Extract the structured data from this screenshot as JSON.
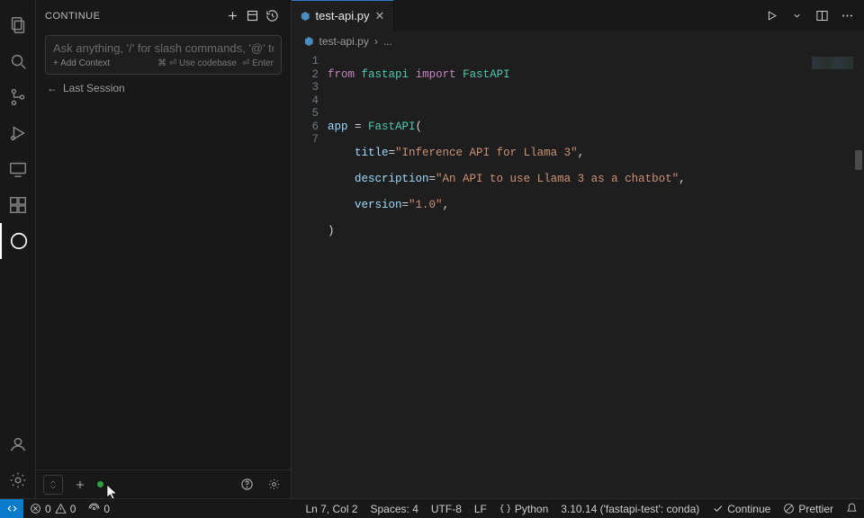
{
  "sidebar": {
    "title": "CONTINUE",
    "input_placeholder": "Ask anything, '/' for slash commands, '@' to add",
    "add_context": "+ Add Context",
    "hint_codebase": "⌘ ⏎ Use codebase",
    "hint_enter": "⏎ Enter",
    "last_session_arrow": "←",
    "last_session": "Last Session"
  },
  "tab": {
    "filename": "test-api.py",
    "file_icon": "⬢"
  },
  "breadcrumb": {
    "file_icon": "⬢",
    "file": "test-api.py",
    "sep": "›",
    "more": "..."
  },
  "code": {
    "lines": [
      "1",
      "2",
      "3",
      "4",
      "5",
      "6",
      "7"
    ],
    "l1_from": "from",
    "l1_mod": "fastapi",
    "l1_import": "import",
    "l1_cls": "FastAPI",
    "l3_app": "app",
    "l3_eq": " = ",
    "l3_cls": "FastAPI",
    "l3_open": "(",
    "l4_kw": "title",
    "l4_eq": "=",
    "l4_str": "\"Inference API for Llama 3\"",
    "l4_comma": ",",
    "l5_kw": "description",
    "l5_eq": "=",
    "l5_str": "\"An API to use Llama 3 as a chatbot\"",
    "l5_comma": ",",
    "l6_kw": "version",
    "l6_eq": "=",
    "l6_str": "\"1.0\"",
    "l6_comma": ",",
    "l7_close": ")"
  },
  "status": {
    "errors": "0",
    "warnings": "0",
    "ports": "0",
    "cursor": "Ln 7, Col 2",
    "spaces": "Spaces: 4",
    "encoding": "UTF-8",
    "eol": "LF",
    "language": "Python",
    "interpreter": "3.10.14 ('fastapi-test': conda)",
    "continue": "Continue",
    "prettier": "Prettier"
  }
}
